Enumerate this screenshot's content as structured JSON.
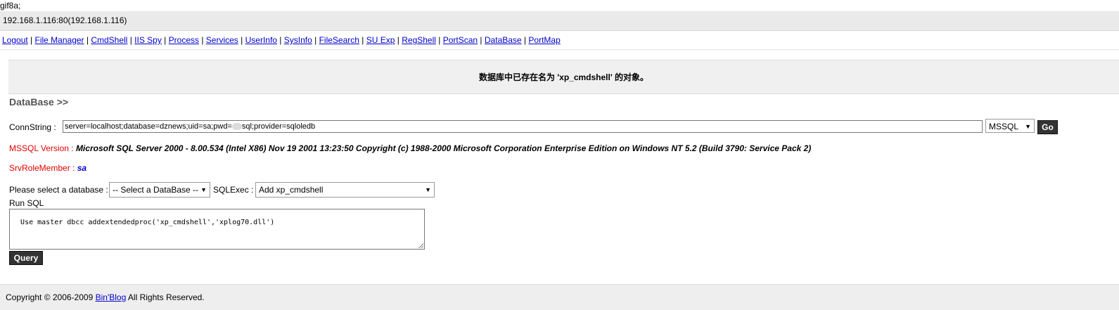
{
  "top_text": "gif8a;",
  "host": "192.168.1.116:80(192.168.1.116)",
  "nav": {
    "items": [
      "Logout",
      "File Manager",
      "CmdShell",
      "IIS Spy",
      "Process",
      "Services",
      "UserInfo",
      "SysInfo",
      "FileSearch",
      "SU Exp",
      "RegShell",
      "PortScan",
      "DataBase",
      "PortMap"
    ],
    "separator": " | "
  },
  "message": "数据库中已存在名为 'xp_cmdshell' 的对象。",
  "section_title": "DataBase >>",
  "conn": {
    "label": "ConnString :",
    "value_part1": "server=localhost;database=dznews;uid=sa;pwd=",
    "value_part2": "sql;provider=sqloledb",
    "db_type": "MSSQL",
    "go_label": "Go"
  },
  "version": {
    "label": "MSSQL Version : ",
    "value": "Microsoft SQL Server 2000 - 8.00.534 (Intel X86) Nov 19 2001 13:23:50 Copyright (c) 1988-2000 Microsoft Corporation Enterprise Edition on Windows NT 5.2 (Build 3790: Service Pack 2)"
  },
  "srvrole": {
    "label": "SrvRoleMember : ",
    "value": "sa"
  },
  "select_db": {
    "label": "Please select a database :",
    "value": "-- Select a DataBase --"
  },
  "sqlexec": {
    "label": "SQLExec :",
    "value": "Add xp_cmdshell"
  },
  "run_sql": {
    "label": "Run SQL",
    "value": "Use master dbcc addextendedproc('xp_cmdshell','xplog70.dll')",
    "query_label": "Query"
  },
  "footer": {
    "prefix": "Copyright © 2006-2009 ",
    "link": "Bin'Blog",
    "suffix": " All Rights Reserved."
  }
}
